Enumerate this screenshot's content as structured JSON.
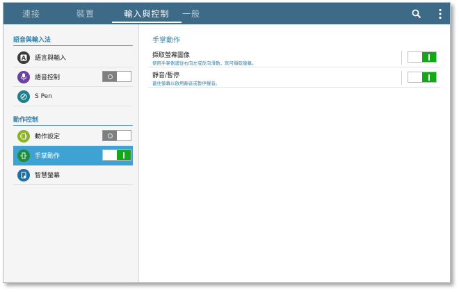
{
  "topbar": {
    "tabs": [
      {
        "label": "連接"
      },
      {
        "label": "裝置"
      },
      {
        "label": "輸入與控制"
      },
      {
        "label": "一般"
      }
    ],
    "active_tab": 2,
    "icons": [
      "search-icon",
      "more-vertical-icon"
    ]
  },
  "sidebar": {
    "sections": [
      {
        "title": "語音與輸入法"
      },
      {
        "title": "動作控制"
      }
    ],
    "items": [
      {
        "label": "語言與輸入",
        "icon": "keyboard-a-icon",
        "icon_color": "#3b3b3b"
      },
      {
        "label": "語音控制",
        "icon": "microphone-icon",
        "icon_color": "#6a3fa6",
        "toggle": "off"
      },
      {
        "label": "S Pen",
        "icon": "s-pen-icon",
        "icon_color": "#1f7f8f"
      },
      {
        "label": "動作設定",
        "icon": "phone-motion-icon",
        "icon_color": "#8db32a",
        "toggle": "off"
      },
      {
        "label": "手掌動作",
        "icon": "palm-motion-icon",
        "icon_color": "#1e8c3e",
        "toggle": "on",
        "selected": true
      },
      {
        "label": "智慧螢幕",
        "icon": "smart-screen-icon",
        "icon_color": "#1f6fa3"
      }
    ]
  },
  "main": {
    "title": "手掌動作",
    "rows": [
      {
        "title": "擷取螢幕圖像",
        "desc": "使用手掌側邊從右向左或反向滑動，就可擷取螢幕。",
        "toggle": "on"
      },
      {
        "title": "靜音/暫停",
        "desc": "蓋住螢幕以啟用靜音或暫停聲音。",
        "toggle": "on"
      }
    ]
  },
  "colors": {
    "topbar": "#3c6a87",
    "accent": "#3a84ab",
    "selected": "#3ea3d3",
    "toggle_on": "#13a815",
    "toggle_off": "#7d7f81"
  }
}
